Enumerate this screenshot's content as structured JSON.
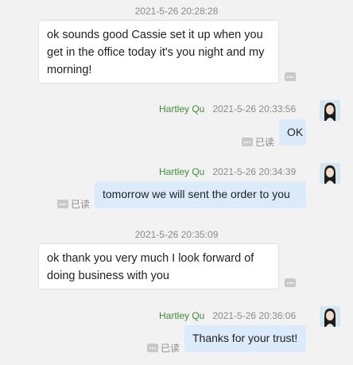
{
  "messages": [
    {
      "timestamp": "2021-5-26 20:28:28",
      "text": "ok sounds good Cassie set it up when you get in the office today it's you night and my morning!"
    },
    {
      "sender": "Hartley Qu",
      "timestamp": "2021-5-26 20:33:56",
      "text": "OK",
      "status": "已读"
    },
    {
      "sender": "Hartley Qu",
      "timestamp": "2021-5-26 20:34:39",
      "text": "tomorrow we will sent the order to you",
      "status": "已读"
    },
    {
      "timestamp": "2021-5-26 20:35:09",
      "text": "ok thank you very much I look forward of doing business with you"
    },
    {
      "sender": "Hartley Qu",
      "timestamp": "2021-5-26 20:36:06",
      "text": "Thanks for your trust!",
      "status": "已读"
    }
  ],
  "icons": {
    "more": "more-dots-icon",
    "avatar": "user-avatar"
  },
  "colors": {
    "sender_name": "#3e8c3a",
    "outgoing_bubble": "#dcebfb",
    "incoming_bubble": "#ffffff",
    "timestamp": "#8a8a8a"
  }
}
